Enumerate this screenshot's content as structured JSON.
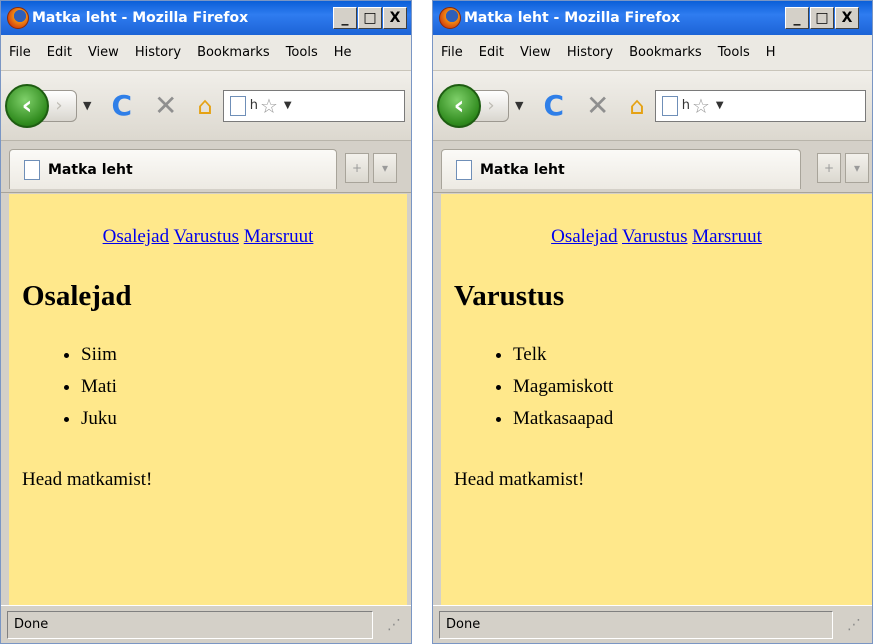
{
  "windows": [
    {
      "title": "Matka leht - Mozilla Firefox",
      "window_buttons": [
        "_",
        "□",
        "X"
      ],
      "menu": [
        "File",
        "Edit",
        "View",
        "History",
        "Bookmarks",
        "Tools",
        "He"
      ],
      "url_text": "h",
      "tab_label": "Matka leht",
      "tab_buttons": [
        "+",
        "▾"
      ],
      "nav_links": [
        "Osalejad",
        "Varustus",
        "Marsruut"
      ],
      "heading": "Osalejad",
      "items": [
        "Siim",
        "Mati",
        "Juku"
      ],
      "footer": "Head matkamist!",
      "status": "Done"
    },
    {
      "title": "Matka leht - Mozilla Firefox",
      "window_buttons": [
        "_",
        "□",
        "X"
      ],
      "menu": [
        "File",
        "Edit",
        "View",
        "History",
        "Bookmarks",
        "Tools",
        "H"
      ],
      "url_text": "h",
      "tab_label": "Matka leht",
      "tab_buttons": [
        "+",
        "▾"
      ],
      "nav_links": [
        "Osalejad",
        "Varustus",
        "Marsruut"
      ],
      "heading": "Varustus",
      "items": [
        "Telk",
        "Magamiskott",
        "Matkasaapad"
      ],
      "footer": "Head matkamist!",
      "status": "Done"
    }
  ],
  "colors": {
    "page_background": "#ffe88b",
    "link": "#0000ee",
    "titlebar": "#2f7cf0"
  },
  "icons": [
    "firefox-logo-icon",
    "back-arrow-icon",
    "forward-arrow-icon",
    "reload-icon",
    "stop-icon",
    "home-icon",
    "page-icon",
    "bookmark-star-icon",
    "resize-grip-icon"
  ]
}
